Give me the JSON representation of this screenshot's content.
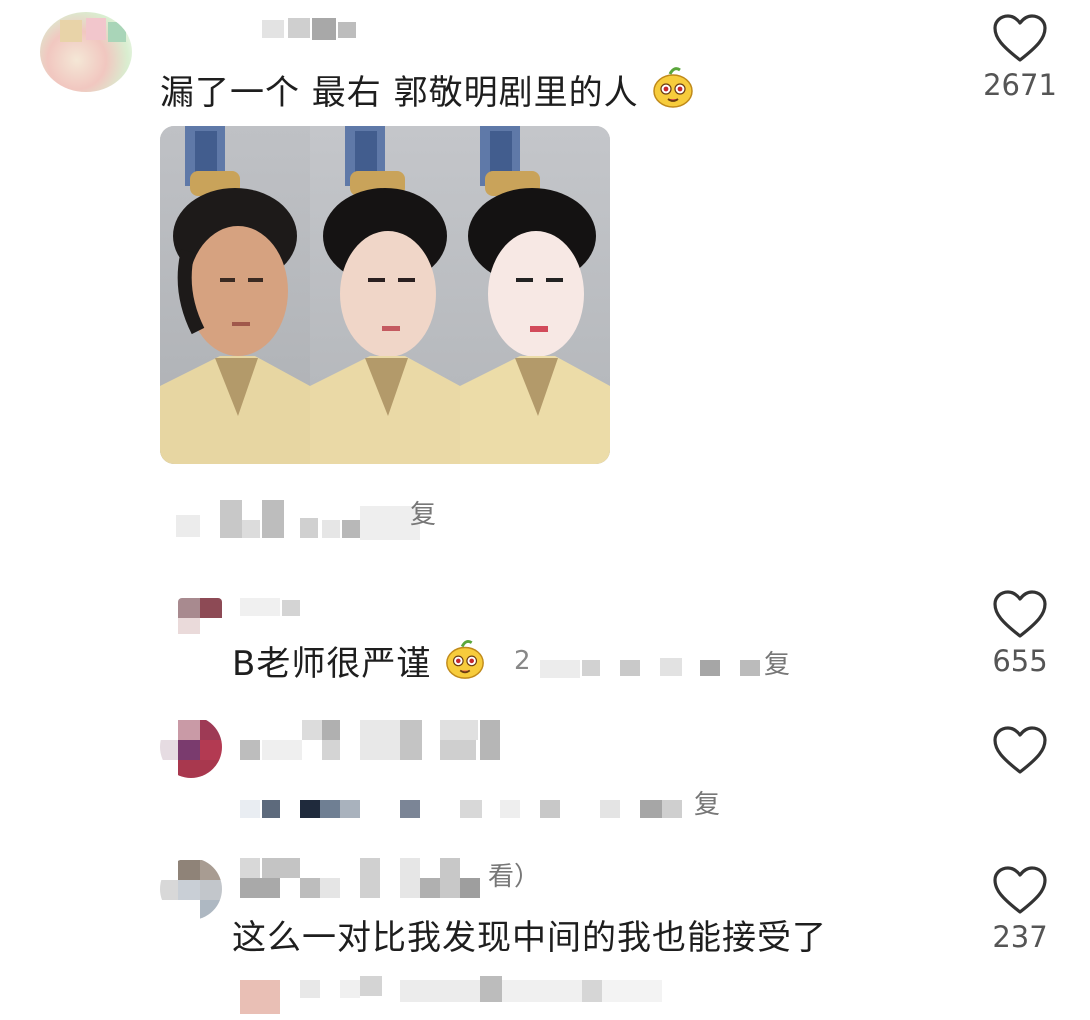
{
  "comments": [
    {
      "text": "漏了一个 最右 郭敬明剧里的人",
      "like_count": "2671",
      "image_alt_panels": 3,
      "reply_fragment": "复"
    },
    {
      "text": "B老师很严谨",
      "fragment_num": "2",
      "reply_fragment": "复",
      "like_count": "655"
    },
    {
      "text": "",
      "reply_fragment": "复"
    },
    {
      "author_fragment": "看）",
      "text": "这么一对比我发现中间的我也能接受了",
      "like_count": "237"
    }
  ],
  "icons": {
    "like": "heart-outline-icon",
    "emoji": "cartoon-face-emoji"
  },
  "colors": {
    "text": "#1e1e1e",
    "count": "#555555",
    "heart": "#333333"
  }
}
